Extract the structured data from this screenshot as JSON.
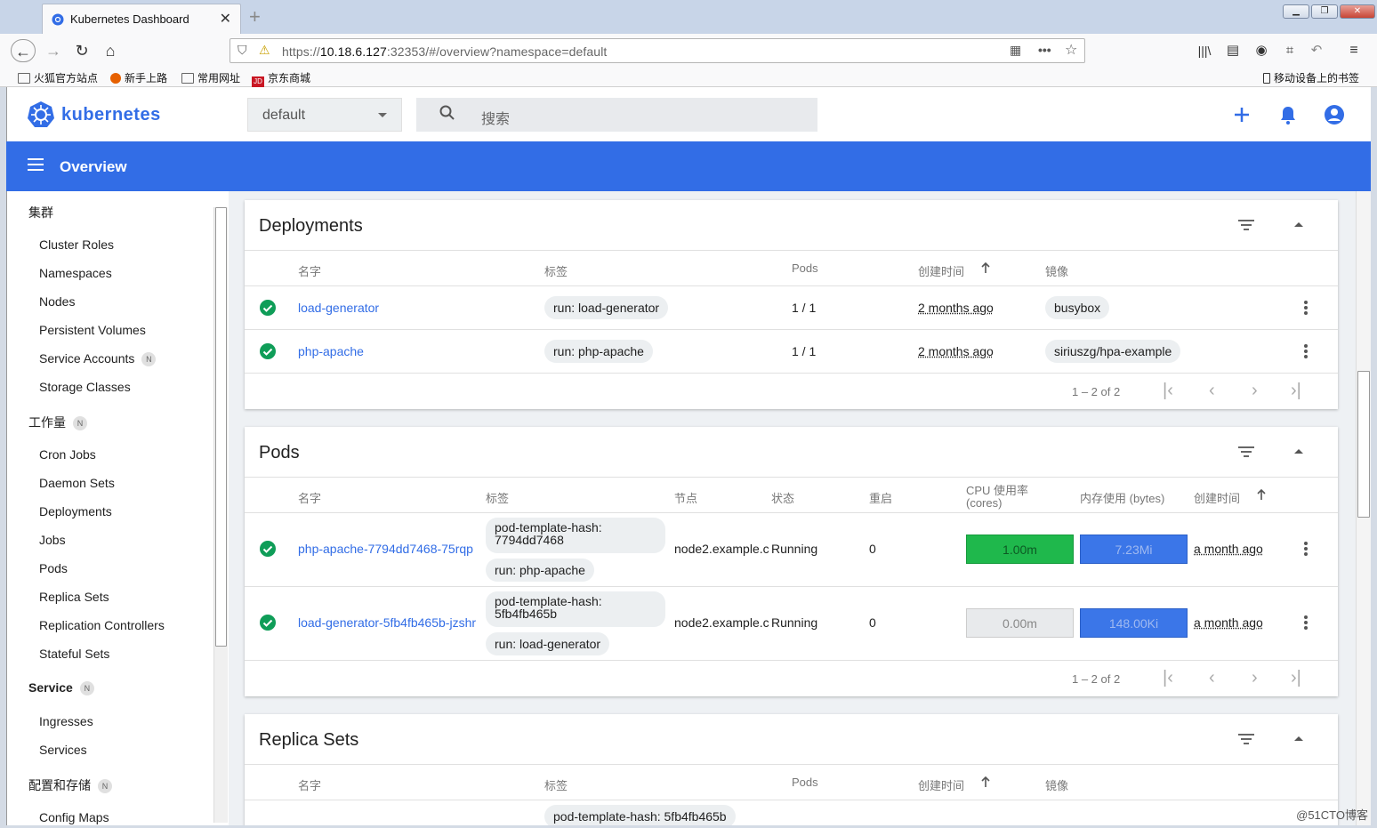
{
  "browser": {
    "tab_title": "Kubernetes Dashboard",
    "url_prefix": "https://",
    "url_host": "10.18.6.127",
    "url_rest": ":32353/#/overview?namespace=default",
    "bookmarks": [
      "火狐官方站点",
      "新手上路",
      "常用网址",
      "京东商城"
    ],
    "mobile_bookmarks": "移动设备上的书签"
  },
  "header": {
    "brand": "kubernetes",
    "namespace": "default",
    "search_placeholder": "搜索",
    "page_title": "Overview"
  },
  "sidebar": {
    "cluster": {
      "label": "集群",
      "items": [
        "Cluster Roles",
        "Namespaces",
        "Nodes",
        "Persistent Volumes",
        "Service Accounts",
        "Storage Classes"
      ]
    },
    "workloads": {
      "label": "工作量",
      "badge": "N",
      "items": [
        "Cron Jobs",
        "Daemon Sets",
        "Deployments",
        "Jobs",
        "Pods",
        "Replica Sets",
        "Replication Controllers",
        "Stateful Sets"
      ]
    },
    "service": {
      "label": "Service",
      "badge": "N",
      "items": [
        "Ingresses",
        "Services"
      ]
    },
    "config": {
      "label": "配置和存储",
      "badge": "N",
      "items": [
        "Config Maps"
      ]
    },
    "service_accounts_badge": "N"
  },
  "deployments": {
    "title": "Deployments",
    "columns": [
      "名字",
      "标签",
      "Pods",
      "创建时间",
      "镜像"
    ],
    "rows": [
      {
        "name": "load-generator",
        "label": "run: load-generator",
        "pods": "1 / 1",
        "created": "2 months ago",
        "image": "busybox"
      },
      {
        "name": "php-apache",
        "label": "run: php-apache",
        "pods": "1 / 1",
        "created": "2 months ago",
        "image": "siriuszg/hpa-example"
      }
    ],
    "pager": "1 – 2 of 2"
  },
  "pods": {
    "title": "Pods",
    "columns": [
      "名字",
      "标签",
      "节点",
      "状态",
      "重启",
      "CPU 使用率",
      "(cores)",
      "内存使用 (bytes)",
      "创建时间"
    ],
    "rows": [
      {
        "name": "php-apache-7794dd7468-75rqp",
        "label1": "pod-template-hash: 7794dd7468",
        "label2": "run: php-apache",
        "node": "node2.example.c",
        "status": "Running",
        "restarts": "0",
        "cpu": "1.00m",
        "mem": "7.23Mi",
        "created": "a month ago"
      },
      {
        "name": "load-generator-5fb4fb465b-jzshr",
        "label1": "pod-template-hash: 5fb4fb465b",
        "label2": "run: load-generator",
        "node": "node2.example.c",
        "status": "Running",
        "restarts": "0",
        "cpu": "0.00m",
        "mem": "148.00Ki",
        "created": "a month ago"
      }
    ],
    "pager": "1 – 2 of 2"
  },
  "replicasets": {
    "title": "Replica Sets",
    "columns": [
      "名字",
      "标签",
      "Pods",
      "创建时间",
      "镜像"
    ],
    "partial_label": "pod-template-hash: 5fb4fb465b"
  },
  "colors": {
    "k8s_blue": "#326de6",
    "cpu_bar": "#1fb84c",
    "mem_bar": "#3b76e8",
    "ok_green": "#0f9d58"
  },
  "watermark": "@51CTO博客"
}
